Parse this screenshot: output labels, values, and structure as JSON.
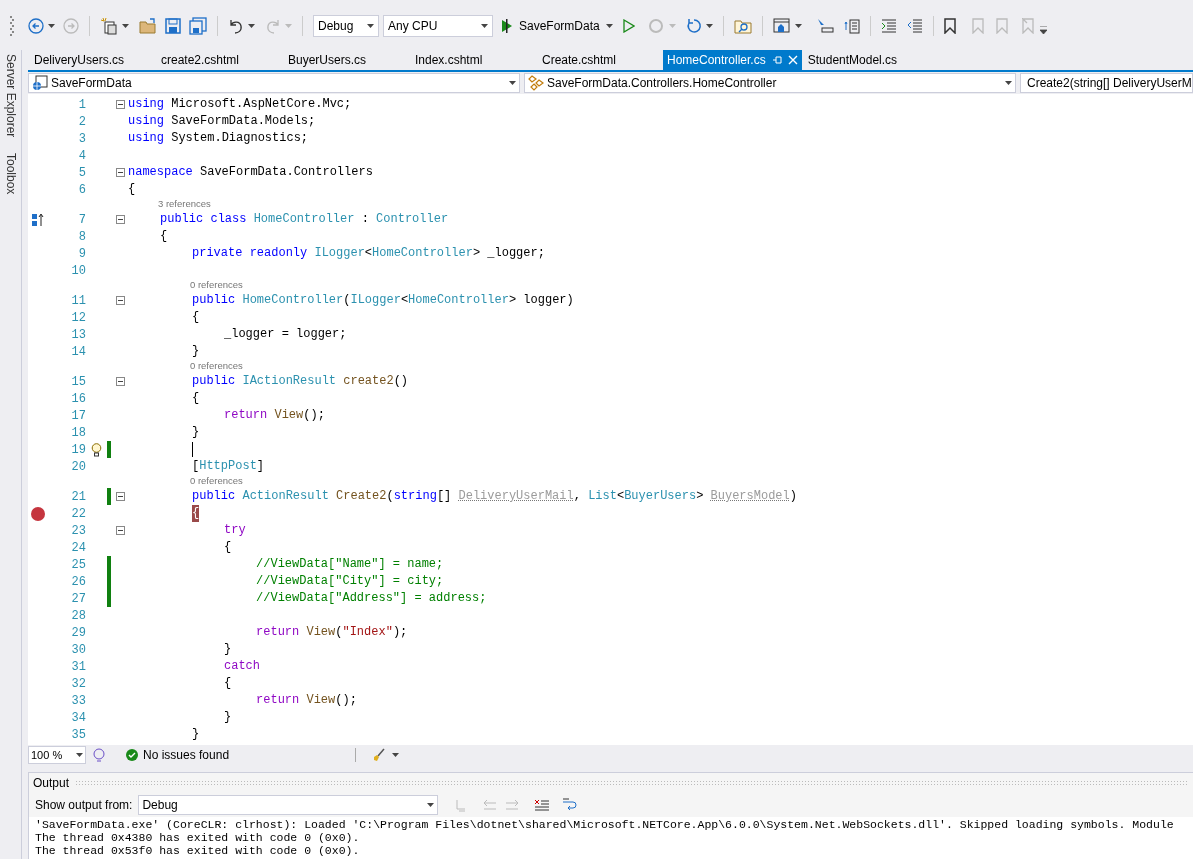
{
  "toolbar": {
    "configuration": "Debug",
    "platform": "Any CPU",
    "startup_project": "SaveFormData"
  },
  "side_tabs": [
    "Server Explorer",
    "Toolbox"
  ],
  "tabs": [
    {
      "label": "DeliveryUsers.cs",
      "selected": false
    },
    {
      "label": "create2.cshtml",
      "selected": false
    },
    {
      "label": "BuyerUsers.cs",
      "selected": false
    },
    {
      "label": "Index.cshtml",
      "selected": false
    },
    {
      "label": "Create.cshtml",
      "selected": false
    },
    {
      "label": "HomeController.cs",
      "selected": true
    },
    {
      "label": "StudentModel.cs",
      "selected": false
    }
  ],
  "navigation": {
    "project": "SaveFormData",
    "type": "SaveFormData.Controllers.HomeController",
    "member": "Create2(string[] DeliveryUserM"
  },
  "code_lines": [
    {
      "number": "1",
      "fold": true,
      "tokens": [
        {
          "kind": "kw",
          "text": "using"
        },
        {
          "kind": "plain",
          "text": " Microsoft.AspNetCore.Mvc;"
        }
      ]
    },
    {
      "number": "2",
      "tokens": [
        {
          "kind": "kw",
          "text": "using"
        },
        {
          "kind": "plain",
          "text": " SaveFormData.Models;"
        }
      ]
    },
    {
      "number": "3",
      "tokens": [
        {
          "kind": "kw",
          "text": "using"
        },
        {
          "kind": "plain",
          "text": " System.Diagnostics;"
        }
      ]
    },
    {
      "number": "4"
    },
    {
      "number": "5",
      "fold": true,
      "tokens": [
        {
          "kind": "kw",
          "text": "namespace"
        },
        {
          "kind": "plain",
          "text": " SaveFormData.Controllers"
        }
      ]
    },
    {
      "number": "6",
      "tokens": [
        {
          "kind": "plain",
          "text": "{"
        }
      ]
    },
    {
      "number": "7",
      "fold": true,
      "inherits": true,
      "codelens": "3 references",
      "tokens": [
        {
          "kind": "kw",
          "text": "    public"
        },
        {
          "kind": "kw",
          "text": " class"
        },
        {
          "kind": "type",
          "text": " HomeController"
        },
        {
          "kind": "plain",
          "text": " : "
        },
        {
          "kind": "type",
          "text": "Controller"
        }
      ]
    },
    {
      "number": "8",
      "tokens": [
        {
          "kind": "plain",
          "text": "    {"
        }
      ]
    },
    {
      "number": "9",
      "tokens": [
        {
          "kind": "kw",
          "text": "        private"
        },
        {
          "kind": "kw",
          "text": " readonly"
        },
        {
          "kind": "type",
          "text": " ILogger"
        },
        {
          "kind": "plain",
          "text": "<"
        },
        {
          "kind": "type",
          "text": "HomeController"
        },
        {
          "kind": "plain",
          "text": "> _logger;"
        }
      ]
    },
    {
      "number": "10"
    },
    {
      "number": "11",
      "fold": true,
      "codelens": "0 references",
      "tokens": [
        {
          "kind": "kw",
          "text": "        public"
        },
        {
          "kind": "type",
          "text": " HomeController"
        },
        {
          "kind": "plain",
          "text": "("
        },
        {
          "kind": "type",
          "text": "ILogger"
        },
        {
          "kind": "plain",
          "text": "<"
        },
        {
          "kind": "type",
          "text": "HomeController"
        },
        {
          "kind": "plain",
          "text": "> logger)"
        }
      ]
    },
    {
      "number": "12",
      "tokens": [
        {
          "kind": "plain",
          "text": "        {"
        }
      ]
    },
    {
      "number": "13",
      "tokens": [
        {
          "kind": "plain",
          "text": "            _logger = logger;"
        }
      ]
    },
    {
      "number": "14",
      "tokens": [
        {
          "kind": "plain",
          "text": "        }"
        }
      ]
    },
    {
      "number": "15",
      "fold": true,
      "codelens": "0 references",
      "tokens": [
        {
          "kind": "kw",
          "text": "        public"
        },
        {
          "kind": "type",
          "text": " IActionResult"
        },
        {
          "kind": "method",
          "text": " create2"
        },
        {
          "kind": "plain",
          "text": "()"
        }
      ]
    },
    {
      "number": "16",
      "tokens": [
        {
          "kind": "plain",
          "text": "        {"
        }
      ]
    },
    {
      "number": "17",
      "tokens": [
        {
          "kind": "ctrl",
          "text": "            return"
        },
        {
          "kind": "method",
          "text": " View"
        },
        {
          "kind": "plain",
          "text": "();"
        }
      ]
    },
    {
      "number": "18",
      "tokens": [
        {
          "kind": "plain",
          "text": "        }"
        }
      ]
    },
    {
      "number": "19",
      "changed": true,
      "lightbulb": true,
      "caret": true
    },
    {
      "number": "20",
      "tokens": [
        {
          "kind": "plain",
          "text": "        ["
        },
        {
          "kind": "type",
          "text": "HttpPost"
        },
        {
          "kind": "plain",
          "text": "]"
        }
      ]
    },
    {
      "number": "21",
      "fold": true,
      "changed": true,
      "codelens": "0 references",
      "tokens": [
        {
          "kind": "kw",
          "text": "        public"
        },
        {
          "kind": "type",
          "text": " ActionResult"
        },
        {
          "kind": "method",
          "text": " Create2"
        },
        {
          "kind": "plain",
          "text": "("
        },
        {
          "kind": "kw",
          "text": "string"
        },
        {
          "kind": "plain",
          "text": "[] "
        },
        {
          "kind": "unused",
          "text": "DeliveryUserMail"
        },
        {
          "kind": "plain",
          "text": ", "
        },
        {
          "kind": "type",
          "text": "List"
        },
        {
          "kind": "plain",
          "text": "<"
        },
        {
          "kind": "type",
          "text": "BuyerUsers"
        },
        {
          "kind": "plain",
          "text": "> "
        },
        {
          "kind": "unused",
          "text": "BuyersModel"
        },
        {
          "kind": "plain",
          "text": ")"
        }
      ]
    },
    {
      "number": "22",
      "breakpoint": true,
      "highlight": true,
      "tokens": [
        {
          "kind": "plain",
          "text": "        {"
        }
      ]
    },
    {
      "number": "23",
      "fold": true,
      "tokens": [
        {
          "kind": "ctrl",
          "text": "            try"
        }
      ]
    },
    {
      "number": "24",
      "tokens": [
        {
          "kind": "plain",
          "text": "            {"
        }
      ]
    },
    {
      "number": "25",
      "changed": true,
      "tokens": [
        {
          "kind": "comment",
          "text": "                //ViewData[\"Name\"] = name;"
        }
      ]
    },
    {
      "number": "26",
      "changed": true,
      "tokens": [
        {
          "kind": "comment",
          "text": "                //ViewData[\"City\"] = city;"
        }
      ]
    },
    {
      "number": "27",
      "changed": true,
      "tokens": [
        {
          "kind": "comment",
          "text": "                //ViewData[\"Address\"] = address;"
        }
      ]
    },
    {
      "number": "28"
    },
    {
      "number": "29",
      "tokens": [
        {
          "kind": "ctrl",
          "text": "                return"
        },
        {
          "kind": "method",
          "text": " View"
        },
        {
          "kind": "plain",
          "text": "("
        },
        {
          "kind": "string",
          "text": "\"Index\""
        },
        {
          "kind": "plain",
          "text": ");"
        }
      ]
    },
    {
      "number": "30",
      "tokens": [
        {
          "kind": "plain",
          "text": "            }"
        }
      ]
    },
    {
      "number": "31",
      "tokens": [
        {
          "kind": "ctrl",
          "text": "            catch"
        }
      ]
    },
    {
      "number": "32",
      "tokens": [
        {
          "kind": "plain",
          "text": "            {"
        }
      ]
    },
    {
      "number": "33",
      "tokens": [
        {
          "kind": "ctrl",
          "text": "                return"
        },
        {
          "kind": "method",
          "text": " View"
        },
        {
          "kind": "plain",
          "text": "();"
        }
      ]
    },
    {
      "number": "34",
      "tokens": [
        {
          "kind": "plain",
          "text": "            }"
        }
      ]
    },
    {
      "number": "35",
      "tokens": [
        {
          "kind": "plain",
          "text": "        }"
        }
      ]
    }
  ],
  "status": {
    "zoom": "100 %",
    "issues": "No issues found"
  },
  "output": {
    "title": "Output",
    "show_from_label": "Show output from:",
    "source": "Debug",
    "lines": [
      "'SaveFormData.exe' (CoreCLR: clrhost): Loaded 'C:\\Program Files\\dotnet\\shared\\Microsoft.NETCore.App\\6.0.0\\System.Net.WebSockets.dll'. Skipped loading symbols. Module",
      "The thread 0x4380 has exited with code 0 (0x0).",
      "The thread 0x53f0 has exited with code 0 (0x0)."
    ]
  }
}
